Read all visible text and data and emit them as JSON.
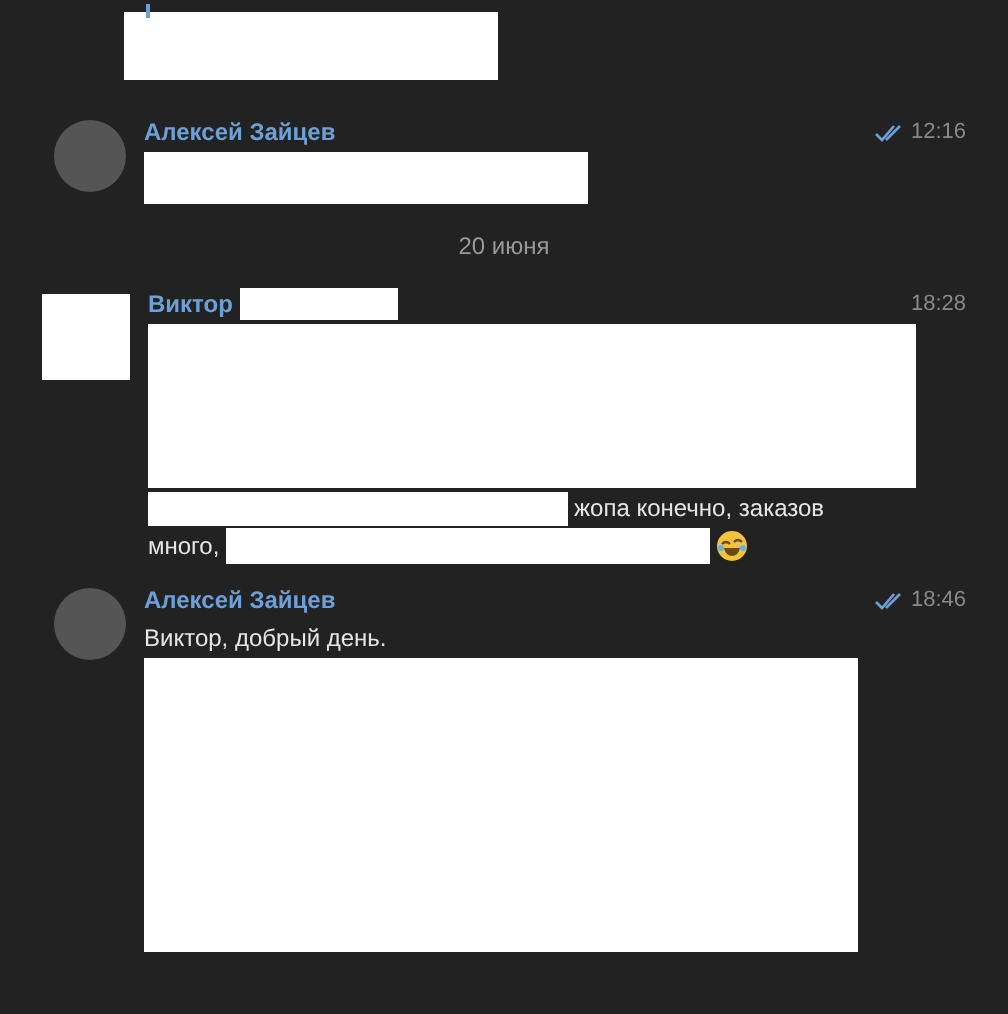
{
  "messages": [
    {
      "kind": "cut_off",
      "lines": [
        [
          {
            "kind": "redacted"
          }
        ]
      ]
    },
    {
      "kind": "message",
      "sender": "Алексей Зайцев",
      "sender_redacted": false,
      "avatar_redacted": false,
      "time": "12:16",
      "read": true,
      "lines": [
        [
          {
            "kind": "redacted"
          }
        ]
      ]
    },
    {
      "kind": "date",
      "text": "20 июня"
    },
    {
      "kind": "message",
      "sender": "Виктор",
      "sender_redacted": true,
      "avatar_redacted": true,
      "time": "18:28",
      "read": false,
      "lines": [
        [
          {
            "kind": "redacted"
          }
        ],
        [
          {
            "kind": "redacted"
          },
          {
            "kind": "text",
            "text": "жопа конечно, заказов"
          }
        ],
        [
          {
            "kind": "text",
            "text": "много,"
          },
          {
            "kind": "redacted"
          },
          {
            "kind": "emoji"
          }
        ]
      ]
    },
    {
      "kind": "message",
      "sender": "Алексей Зайцев",
      "sender_redacted": false,
      "avatar_redacted": false,
      "time": "18:46",
      "read": true,
      "lines": [
        [
          {
            "kind": "text",
            "text": "Виктор, добрый день."
          }
        ],
        [
          {
            "kind": "redacted"
          }
        ]
      ]
    }
  ]
}
